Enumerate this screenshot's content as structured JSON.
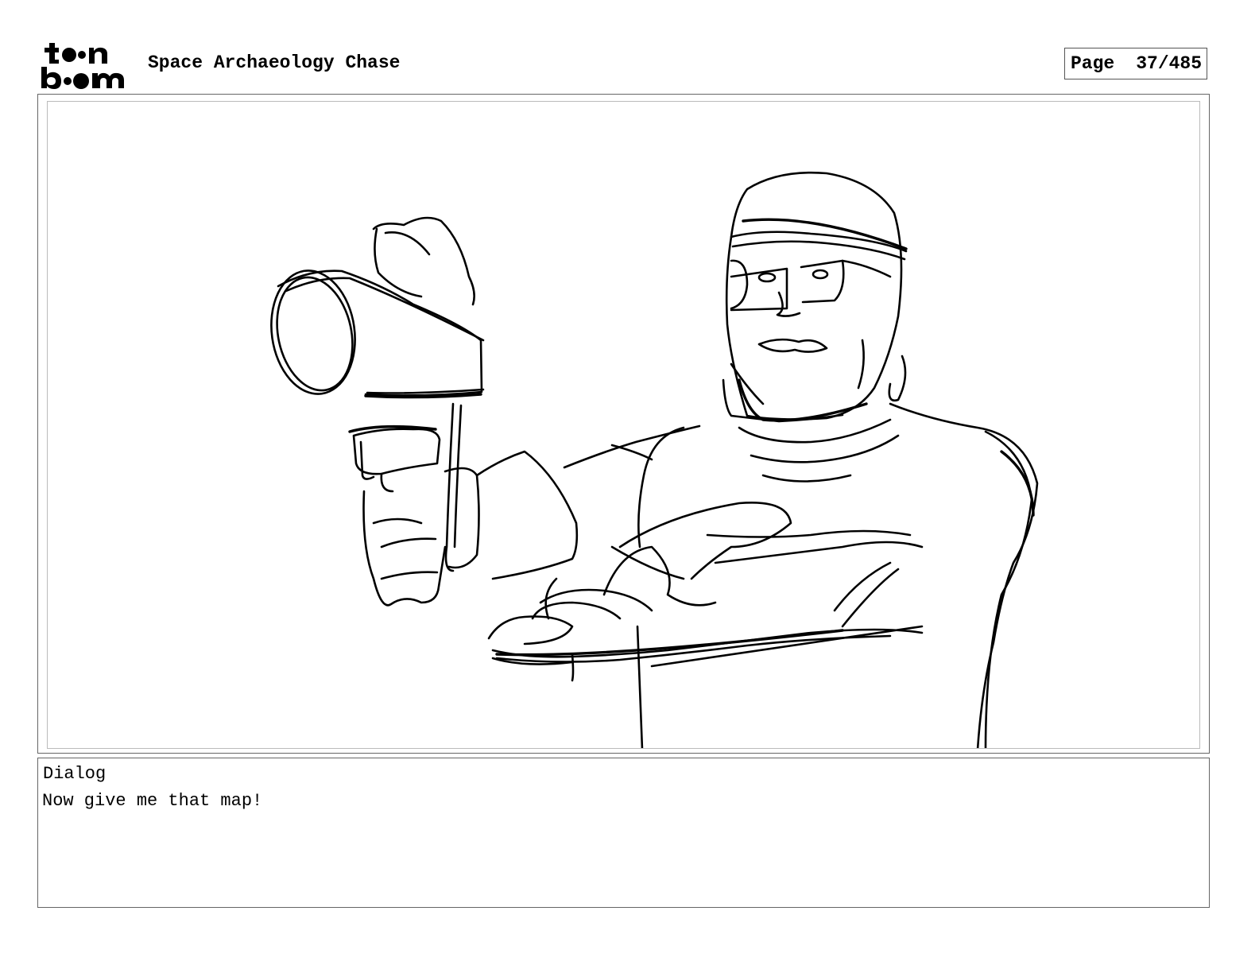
{
  "logo": {
    "icon": "toon-boom-logo",
    "text": "toon boom"
  },
  "header": {
    "project_title": "Space Archaeology Chase",
    "page_label": "Page",
    "page_number": "37/485"
  },
  "panel": {
    "image": "rough-sketch-man-pointing-ray-gun"
  },
  "dialog": {
    "label": "Dialog",
    "text": "Now give me that map!"
  }
}
